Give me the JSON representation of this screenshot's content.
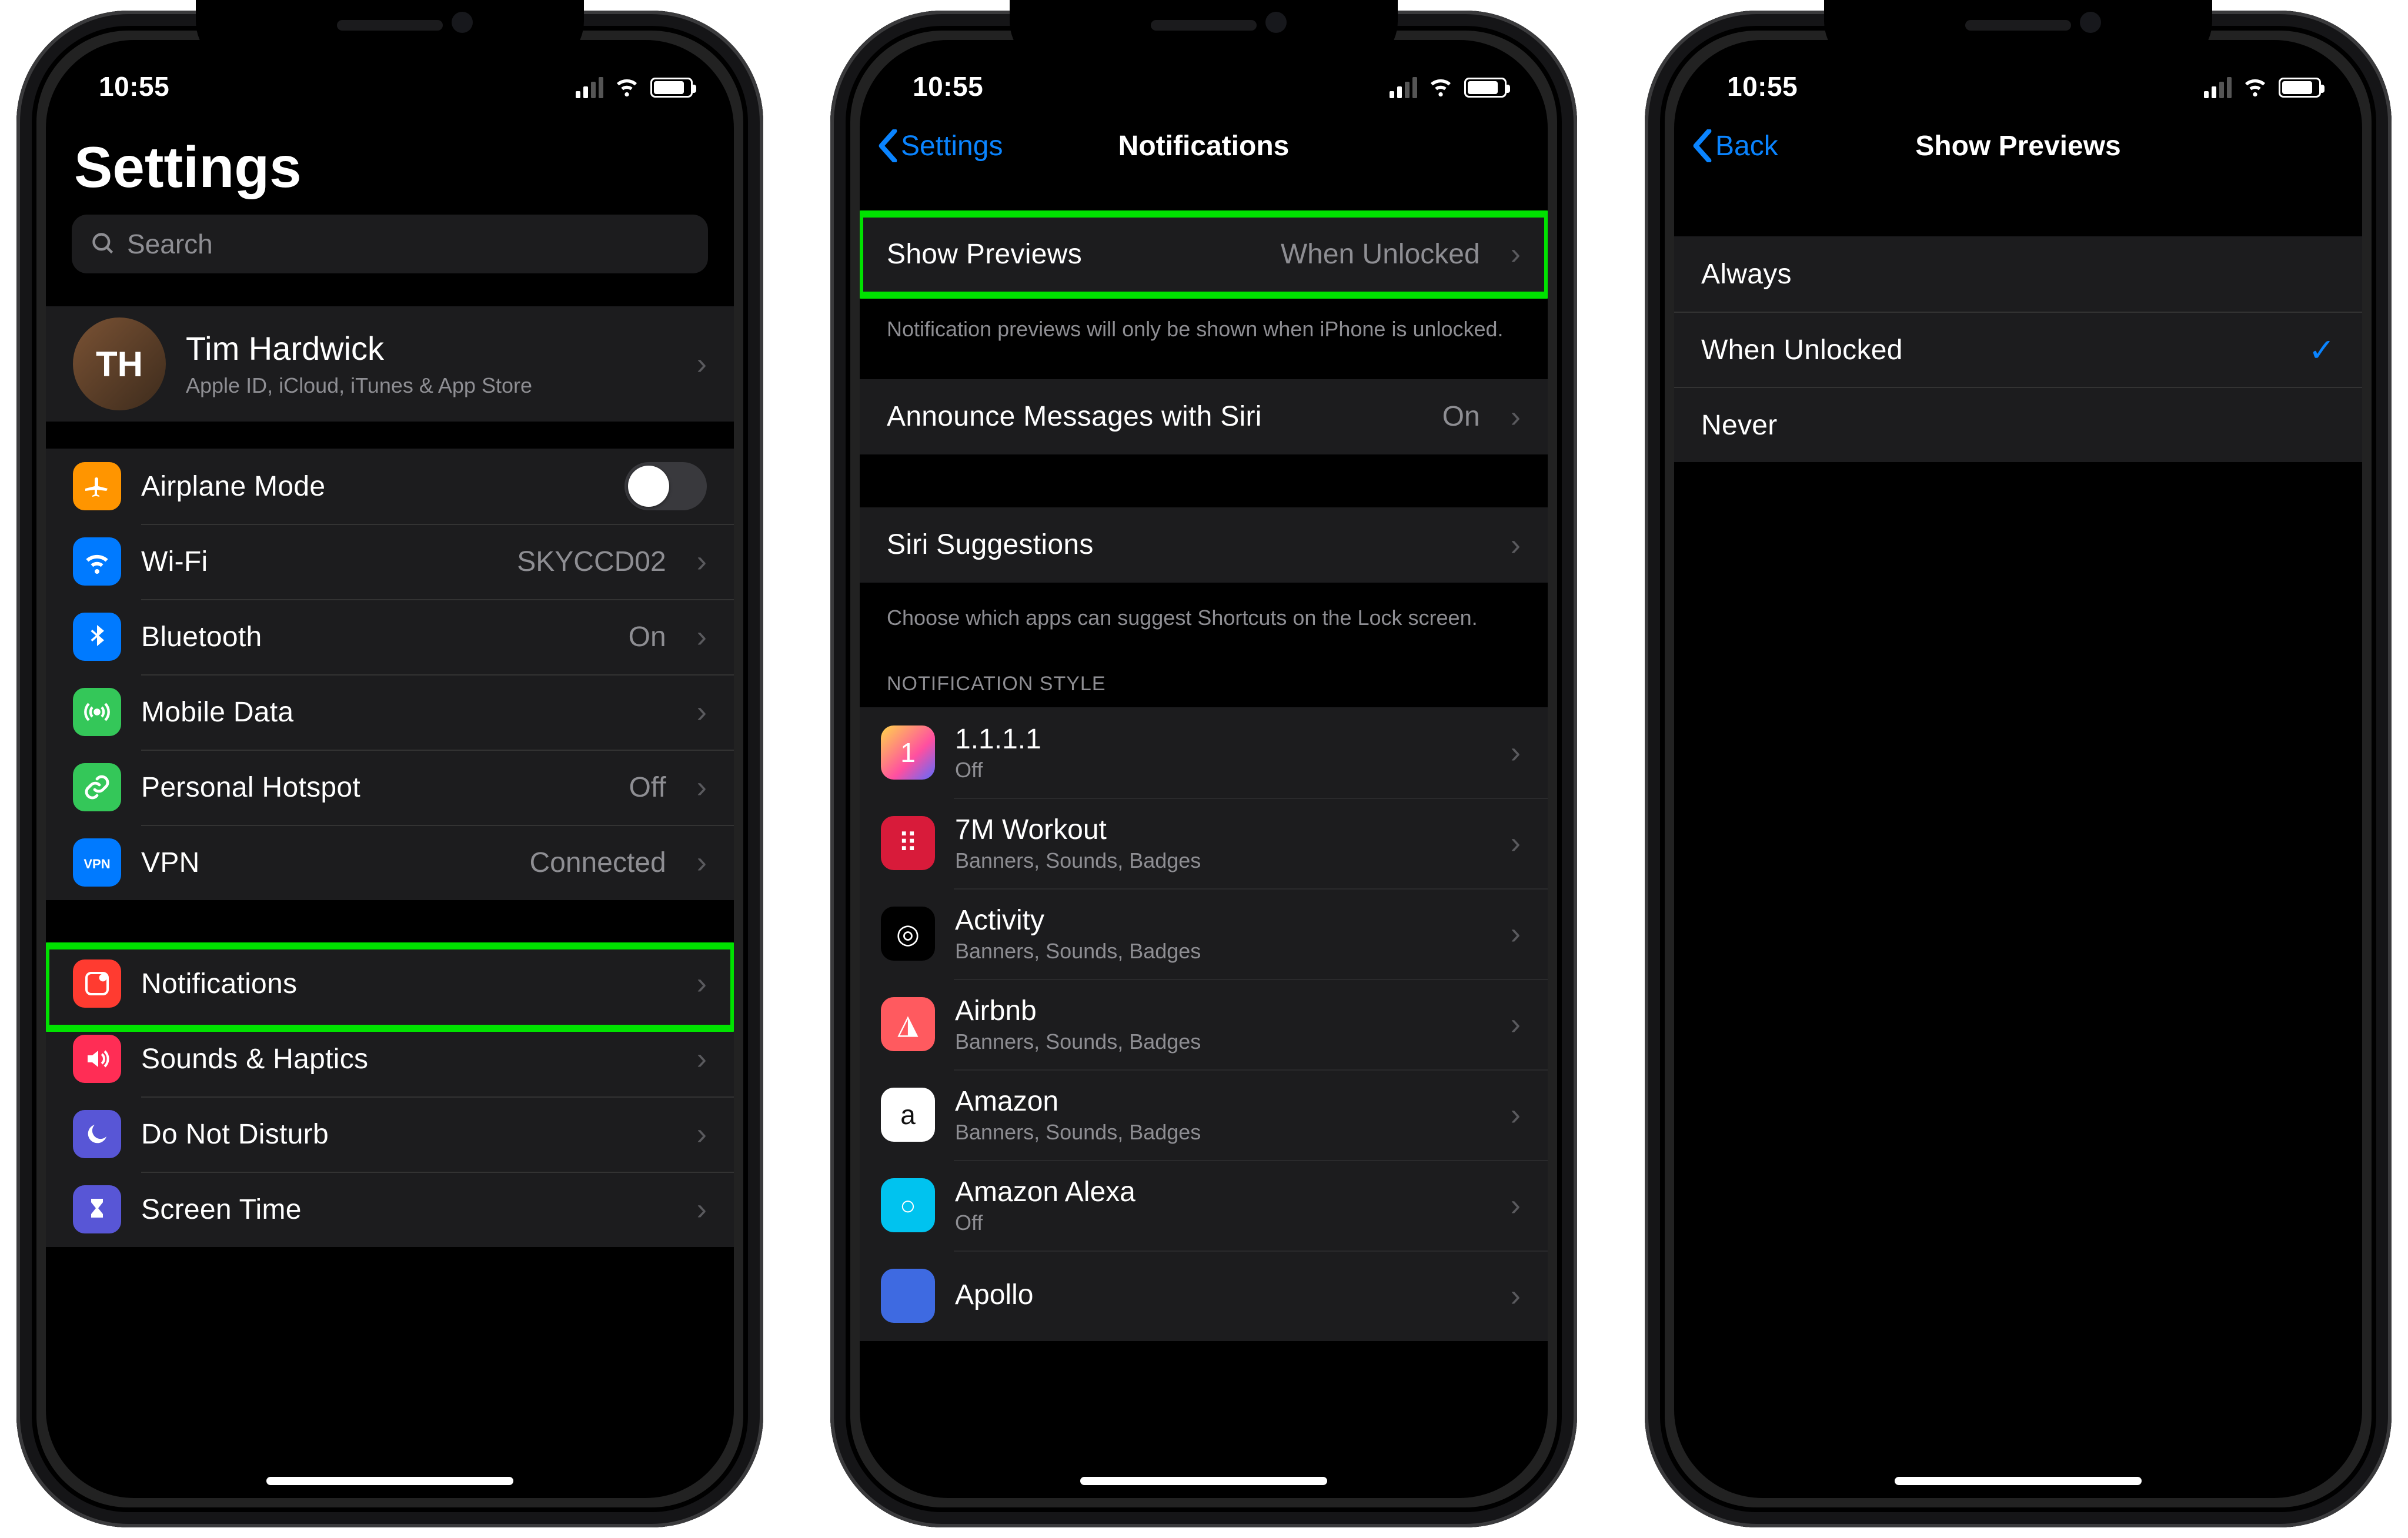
{
  "status": {
    "time": "10:55",
    "signal_bars": 4,
    "signal_active": 2,
    "wifi_glyph": "􀙇",
    "battery_pct": 85
  },
  "screen1": {
    "large_title": "Settings",
    "search_placeholder": "Search",
    "profile": {
      "name": "Tim Hardwick",
      "subtitle": "Apple ID, iCloud, iTunes & App Store",
      "initials": "TH"
    },
    "rows_conn": [
      {
        "icon": "airplane",
        "icon_bg": "#ff9500",
        "label": "Airplane Mode",
        "control": "switch",
        "switch_on": false
      },
      {
        "icon": "wifi",
        "icon_bg": "#007aff",
        "label": "Wi-Fi",
        "value": "SKYCCD02",
        "chevron": true
      },
      {
        "icon": "bluetooth",
        "icon_bg": "#007aff",
        "label": "Bluetooth",
        "value": "On",
        "chevron": true
      },
      {
        "icon": "antenna",
        "icon_bg": "#34c759",
        "label": "Mobile Data",
        "chevron": true
      },
      {
        "icon": "link",
        "icon_bg": "#34c759",
        "label": "Personal Hotspot",
        "value": "Off",
        "chevron": true
      },
      {
        "icon": "vpn",
        "icon_bg": "#007aff",
        "label": "VPN",
        "value": "Connected",
        "chevron": true
      }
    ],
    "rows_notif": [
      {
        "icon": "notifications",
        "icon_bg": "#ff3b30",
        "label": "Notifications",
        "chevron": true,
        "highlight": true
      },
      {
        "icon": "speaker",
        "icon_bg": "#ff2d55",
        "label": "Sounds & Haptics",
        "chevron": true
      },
      {
        "icon": "moon",
        "icon_bg": "#5856d6",
        "label": "Do Not Disturb",
        "chevron": true
      },
      {
        "icon": "hourglass",
        "icon_bg": "#5856d6",
        "label": "Screen Time",
        "chevron": true
      }
    ]
  },
  "screen2": {
    "back_label": "Settings",
    "title": "Notifications",
    "row_previews": {
      "label": "Show Previews",
      "value": "When Unlocked",
      "highlight": true
    },
    "previews_footer": "Notification previews will only be shown when iPhone is unlocked.",
    "row_announce": {
      "label": "Announce Messages with Siri",
      "value": "On"
    },
    "row_siri": {
      "label": "Siri Suggestions"
    },
    "siri_footer": "Choose which apps can suggest Shortcuts on the Lock screen.",
    "style_header": "Notification Style",
    "apps": [
      {
        "name": "1.1.1.1",
        "sub": "Off",
        "bg": "linear-gradient(135deg,#ffd54a,#ff4fa0 60%,#5b6bff)",
        "glyph": "1"
      },
      {
        "name": "7M Workout",
        "sub": "Banners, Sounds, Badges",
        "bg": "#d81b3a",
        "glyph": "⠿"
      },
      {
        "name": "Activity",
        "sub": "Banners, Sounds, Badges",
        "bg": "#000",
        "glyph": "◎"
      },
      {
        "name": "Airbnb",
        "sub": "Banners, Sounds, Badges",
        "bg": "#ff5a5f",
        "glyph": "◮"
      },
      {
        "name": "Amazon",
        "sub": "Banners, Sounds, Badges",
        "bg": "#fff",
        "glyph": "a",
        "fg": "#111"
      },
      {
        "name": "Amazon Alexa",
        "sub": "Off",
        "bg": "#00c3ef",
        "glyph": "○"
      },
      {
        "name": "Apollo",
        "sub": "",
        "bg": "#3e6ae1",
        "glyph": ""
      }
    ]
  },
  "screen3": {
    "back_label": "Back",
    "title": "Show Previews",
    "options": [
      {
        "label": "Always",
        "checked": false
      },
      {
        "label": "When Unlocked",
        "checked": true
      },
      {
        "label": "Never",
        "checked": false
      }
    ]
  }
}
